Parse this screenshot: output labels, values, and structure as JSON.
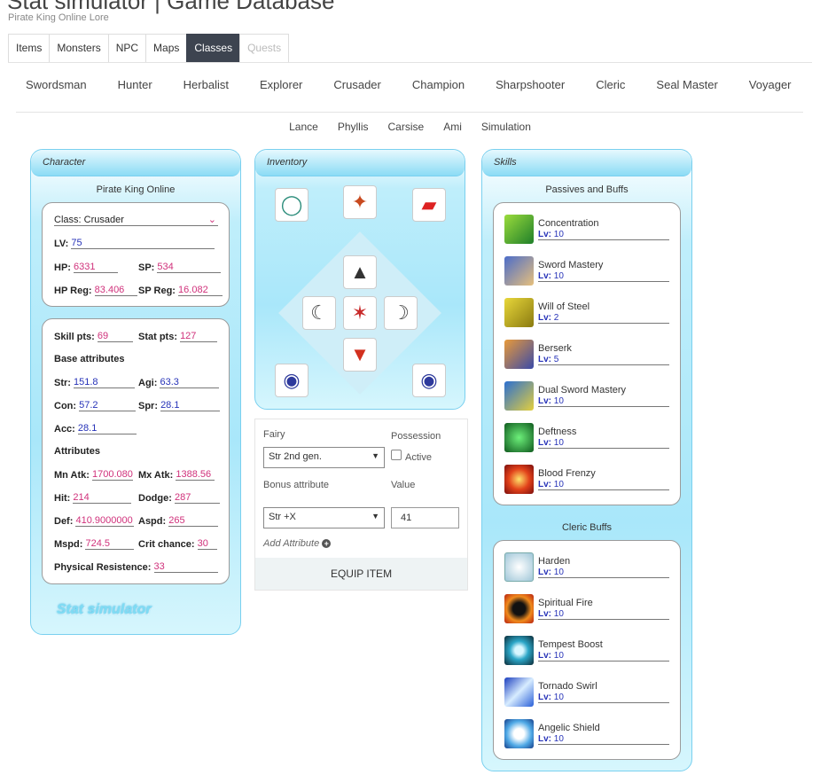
{
  "header": {
    "title": "Stat simulator | Game Database",
    "subtitle": "Pirate King Online Lore"
  },
  "tabs": [
    {
      "label": "Items"
    },
    {
      "label": "Monsters"
    },
    {
      "label": "NPC"
    },
    {
      "label": "Maps"
    },
    {
      "label": "Classes"
    },
    {
      "label": "Quests"
    }
  ],
  "class_nav": [
    "Swordsman",
    "Hunter",
    "Herbalist",
    "Explorer",
    "Crusader",
    "Champion",
    "Sharpshooter",
    "Cleric",
    "Seal Master",
    "Voyager"
  ],
  "sub_nav": [
    "Lance",
    "Phyllis",
    "Carsise",
    "Ami",
    "Simulation"
  ],
  "character": {
    "heading": "Character",
    "server": "Pirate King Online",
    "class_label": "Class:",
    "class_value": "Crusader",
    "lv_label": "LV:",
    "lv": "75",
    "hp_label": "HP:",
    "hp": "6331",
    "sp_label": "SP:",
    "sp": "534",
    "hpreg_label": "HP Reg:",
    "hpreg": "83.406",
    "spreg_label": "SP Reg:",
    "spreg": "16.082",
    "skillpts_label": "Skill pts:",
    "skillpts": "69",
    "statpts_label": "Stat pts:",
    "statpts": "127",
    "base_title": "Base attributes",
    "str_label": "Str:",
    "str": "151.8",
    "agi_label": "Agi:",
    "agi": "63.3",
    "con_label": "Con:",
    "con": "57.2",
    "spr_label": "Spr:",
    "spr": "28.1",
    "acc_label": "Acc:",
    "acc": "28.1",
    "attr_title": "Attributes",
    "mnatk_label": "Mn Atk:",
    "mnatk": "1700.080",
    "mxatk_label": "Mx Atk:",
    "mxatk": "1388.56",
    "hit_label": "Hit:",
    "hit": "214",
    "dodge_label": "Dodge:",
    "dodge": "287",
    "def_label": "Def:",
    "def": "410.9000000",
    "aspd_label": "Aspd:",
    "aspd": "265",
    "mspd_label": "Mspd:",
    "mspd": "724.5",
    "crit_label": "Crit chance:",
    "crit": "30",
    "physres_label": "Physical Resistence:",
    "physres": "33",
    "logo": "Stat simulator"
  },
  "inventory": {
    "heading": "Inventory",
    "fairy_label": "Fairy",
    "fairy_value": "Str 2nd gen.",
    "possession_label": "Possession",
    "active_label": "Active",
    "bonus_label": "Bonus attribute",
    "bonus_value": "Str +X",
    "value_label": "Value",
    "value": "41",
    "add_attr": "Add Attribute",
    "equip": "EQUIP ITEM"
  },
  "skills": {
    "heading": "Skills",
    "passives_title": "Passives and Buffs",
    "passives": [
      {
        "name": "Concentration",
        "lv": "10"
      },
      {
        "name": "Sword Mastery",
        "lv": "10"
      },
      {
        "name": "Will of Steel",
        "lv": "2"
      },
      {
        "name": "Berserk",
        "lv": "5"
      },
      {
        "name": "Dual Sword Mastery",
        "lv": "10"
      },
      {
        "name": "Deftness",
        "lv": "10"
      },
      {
        "name": "Blood Frenzy",
        "lv": "10"
      }
    ],
    "cleric_title": "Cleric Buffs",
    "cleric": [
      {
        "name": "Harden",
        "lv": "10"
      },
      {
        "name": "Spiritual Fire",
        "lv": "10"
      },
      {
        "name": "Tempest Boost",
        "lv": "10"
      },
      {
        "name": "Tornado Swirl",
        "lv": "10"
      },
      {
        "name": "Angelic Shield",
        "lv": "10"
      }
    ],
    "lv_label": "Lv:"
  },
  "colors": {
    "accent": "#3d4450",
    "panel": "#a9e7fa",
    "value_blue": "#2632b8",
    "value_pink": "#d0317b"
  }
}
